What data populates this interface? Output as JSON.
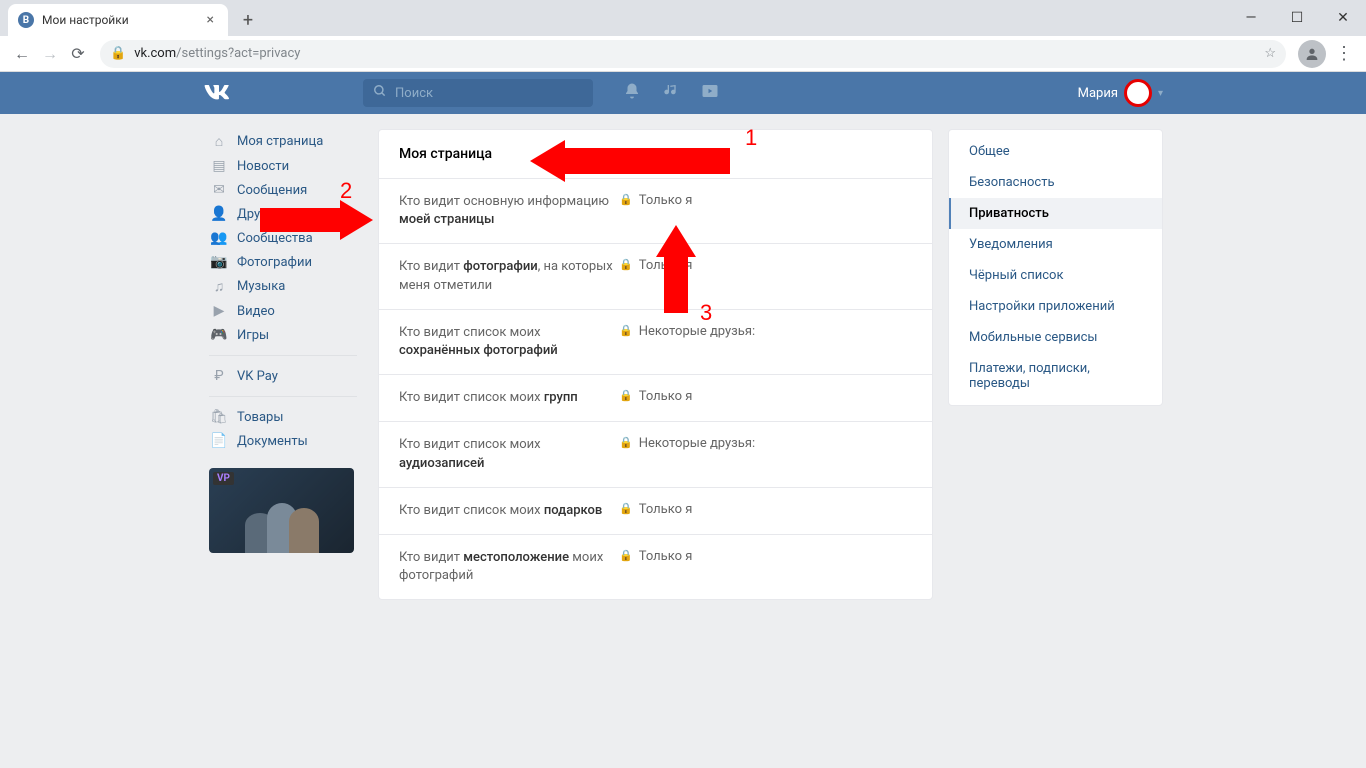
{
  "browser": {
    "tab_title": "Мои настройки",
    "url_host": "vk.com",
    "url_path": "/settings?act=privacy"
  },
  "header": {
    "search_placeholder": "Поиск",
    "user_name": "Мария"
  },
  "left_nav": {
    "items": [
      {
        "icon": "home",
        "label": "Моя страница"
      },
      {
        "icon": "news",
        "label": "Новости"
      },
      {
        "icon": "msg",
        "label": "Сообщения"
      },
      {
        "icon": "friends",
        "label": "Друзья"
      },
      {
        "icon": "groups",
        "label": "Сообщества"
      },
      {
        "icon": "photo",
        "label": "Фотографии"
      },
      {
        "icon": "music",
        "label": "Музыка"
      },
      {
        "icon": "video",
        "label": "Видео"
      },
      {
        "icon": "games",
        "label": "Игры"
      }
    ],
    "items2": [
      {
        "icon": "vkpay",
        "label": "VK Pay"
      }
    ],
    "items3": [
      {
        "icon": "goods",
        "label": "Товары"
      },
      {
        "icon": "docs",
        "label": "Документы"
      }
    ]
  },
  "main": {
    "title": "Моя страница",
    "rows": [
      {
        "label_pre": "Кто видит основную информацию ",
        "label_bold": "моей страницы",
        "value": "Только я"
      },
      {
        "label_pre": "Кто видит ",
        "label_bold": "фотографии",
        "label_post": ", на которых меня отметили",
        "value": "Только я"
      },
      {
        "label_pre": "Кто видит список моих ",
        "label_bold": "сохранённых фотографий",
        "value": "Некоторые друзья:"
      },
      {
        "label_pre": "Кто видит список моих ",
        "label_bold": "групп",
        "value": "Только я"
      },
      {
        "label_pre": "Кто видит список моих ",
        "label_bold": "аудиозаписей",
        "value": "Некоторые друзья:"
      },
      {
        "label_pre": "Кто видит список моих ",
        "label_bold": "подарков",
        "value": "Только я"
      },
      {
        "label_pre": "Кто видит ",
        "label_bold": "местоположение",
        "label_post": " моих фотографий",
        "value": "Только я"
      }
    ]
  },
  "right_menu": {
    "items": [
      {
        "label": "Общее"
      },
      {
        "label": "Безопасность"
      },
      {
        "label": "Приватность",
        "active": true
      },
      {
        "label": "Уведомления"
      },
      {
        "label": "Чёрный список"
      },
      {
        "label": "Настройки приложений"
      },
      {
        "label": "Мобильные сервисы"
      },
      {
        "label": "Платежи, подписки, переводы"
      }
    ]
  },
  "annotations": {
    "n1": "1",
    "n2": "2",
    "n3": "3"
  }
}
